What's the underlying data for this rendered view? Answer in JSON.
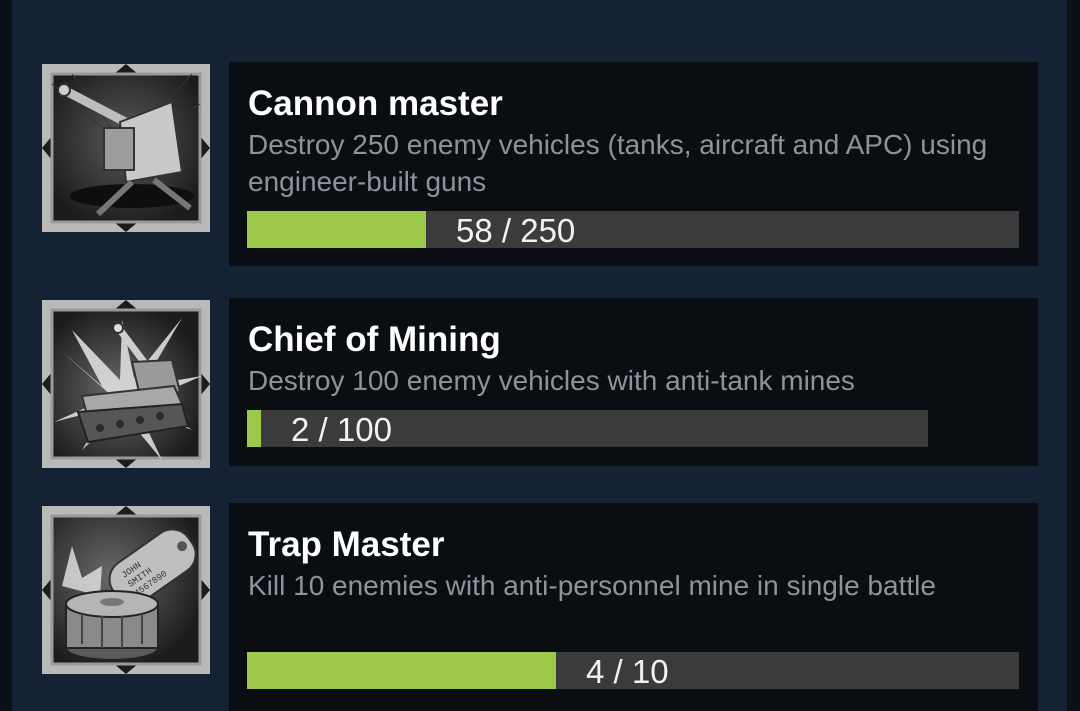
{
  "achievements": [
    {
      "title": "Cannon master",
      "description": "Destroy 250 enemy vehicles (tanks, aircraft and APC) using engineer-built guns",
      "progress_text": "58 / 250",
      "current": 58,
      "target": 250,
      "icon": "cannon-icon"
    },
    {
      "title": "Chief of Mining",
      "description": "Destroy 100 enemy vehicles with anti-tank mines",
      "progress_text": "2 / 100",
      "current": 2,
      "target": 100,
      "icon": "tank-explosion-icon"
    },
    {
      "title": "Trap Master",
      "description": "Kill 10 enemies with anti-personnel mine in single battle",
      "progress_text": "4 / 10",
      "current": 4,
      "target": 10,
      "icon": "mine-dogtag-icon",
      "dogtag_lines": [
        "JOHN",
        "SMITH",
        "4567890"
      ]
    }
  ],
  "colors": {
    "page_background": "#0d1117",
    "panel_background": "#142233",
    "card_background": "#0a0e13",
    "progress_fill": "#9dc94a",
    "progress_track": "#3b3b3b",
    "title_text": "#ffffff",
    "description_text": "#8f9399"
  }
}
